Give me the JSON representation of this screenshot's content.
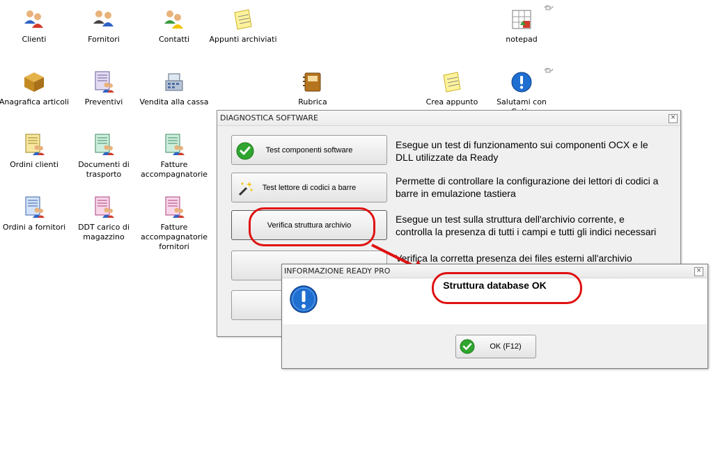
{
  "desktop": {
    "icons": {
      "clienti": "Clienti",
      "fornitori": "Fornitori",
      "contatti": "Contatti",
      "appunti": "Appunti archiviati",
      "notepad": "notepad",
      "anagrafica": "Anagrafica articoli",
      "preventivi": "Preventivi",
      "vendita": "Vendita alla cassa",
      "rubrica": "Rubrica",
      "crea_appunto": "Crea appunto",
      "salutami_1": "Salutami con",
      "salutami_2": "Gatto",
      "ordini_clienti": "Ordini clienti",
      "documenti_1": "Documenti di",
      "documenti_2": "trasporto",
      "fatture_acc_1": "Fatture",
      "fatture_acc_2": "accompagnatorie",
      "ordini_fornitori": "Ordini a fornitori",
      "ddt_1": "DDT carico di",
      "ddt_2": "magazzino",
      "fatture_forn_1": "Fatture",
      "fatture_forn_2": "accompagnatorie",
      "fatture_forn_3": "fornitori"
    }
  },
  "diagnostica": {
    "title": "DIAGNOSTICA SOFTWARE",
    "close": "×",
    "items": [
      {
        "button": "Test componenti software",
        "desc_1": "Esegue un test di funzionamento sui componenti OCX e le",
        "desc_2": "DLL utilizzate da Ready"
      },
      {
        "button": "Test lettore di codici a barre",
        "desc_1": "Permette di controllare la configurazione dei lettori di codici a",
        "desc_2": "barre in emulazione tastiera"
      },
      {
        "button": "Verifica struttura archivio",
        "desc_1": "Esegue un test sulla struttura dell'archivio corrente, e",
        "desc_2": "controlla la presenza di tutti i campi e tutti gli indici necessari"
      },
      {
        "button": "",
        "desc_1": "Verifica la corretta presenza dei files esterni all'archivio",
        "desc_2": ""
      },
      {
        "button": "",
        "desc_1": "",
        "desc_2": ""
      }
    ]
  },
  "info": {
    "title": "INFORMAZIONE READY PRO",
    "close": "×",
    "message": "Struttura database OK",
    "ok_label": "OK (F12)"
  },
  "colors": {
    "callout": "#e01010",
    "info_icon": "#1f6fd1",
    "check": "#2fa52f"
  }
}
